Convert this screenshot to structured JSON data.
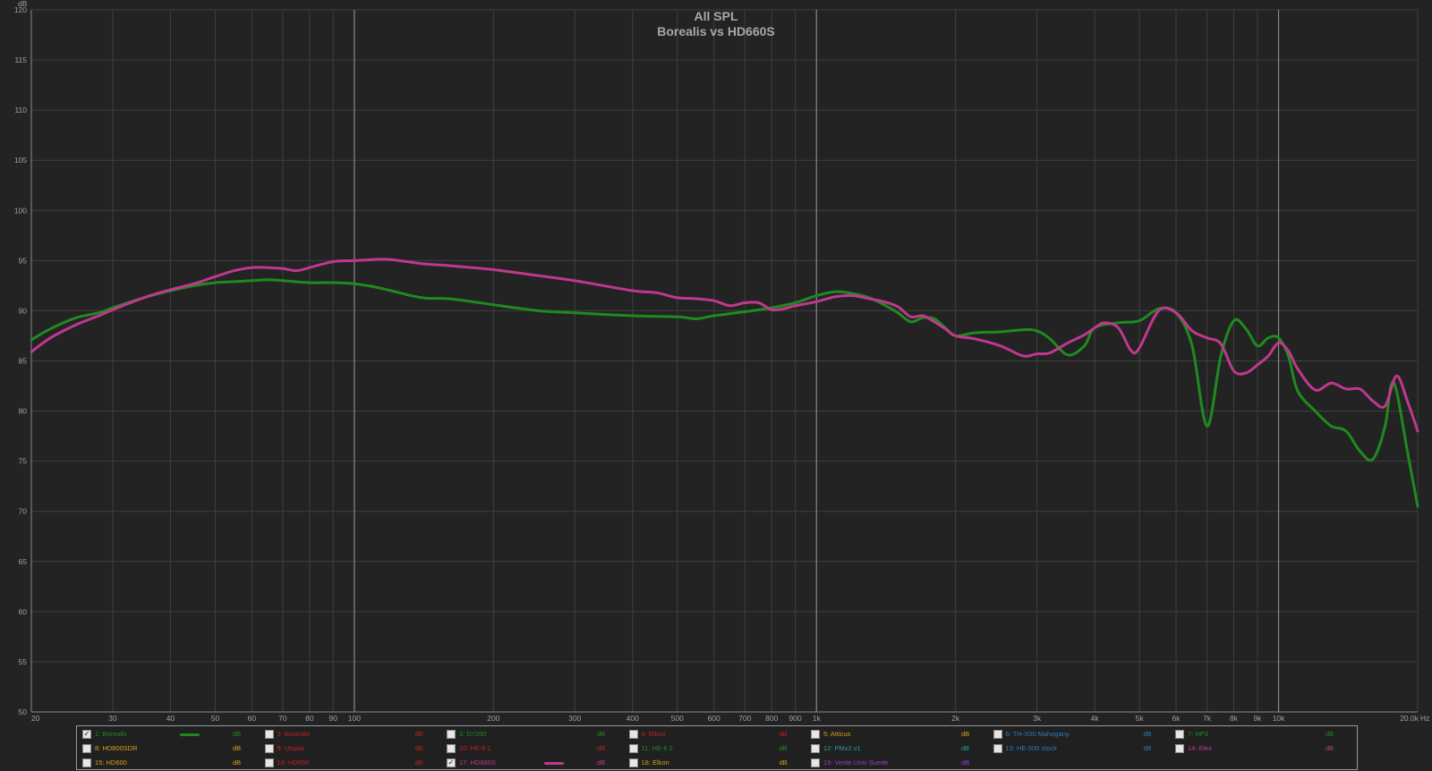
{
  "chart_data": {
    "type": "line",
    "title": "All SPL",
    "subtitle": "Borealis vs HD660S",
    "xlabel": "Hz",
    "ylabel": "dB",
    "xscale": "log",
    "xlim": [
      20,
      20000
    ],
    "ylim": [
      50,
      120
    ],
    "grid": true,
    "y_ticks": [
      "50",
      "55",
      "60",
      "65",
      "70",
      "75",
      "80",
      "85",
      "90",
      "95",
      "100",
      "105",
      "110",
      "115",
      "120"
    ],
    "x_ticks": [
      {
        "v": 20,
        "label": "20"
      },
      {
        "v": 30,
        "label": "30"
      },
      {
        "v": 40,
        "label": "40"
      },
      {
        "v": 50,
        "label": "50"
      },
      {
        "v": 60,
        "label": "60"
      },
      {
        "v": 70,
        "label": "70"
      },
      {
        "v": 80,
        "label": "80"
      },
      {
        "v": 90,
        "label": "90"
      },
      {
        "v": 100,
        "label": "100"
      },
      {
        "v": 200,
        "label": "200"
      },
      {
        "v": 300,
        "label": "300"
      },
      {
        "v": 400,
        "label": "400"
      },
      {
        "v": 500,
        "label": "500"
      },
      {
        "v": 600,
        "label": "600"
      },
      {
        "v": 700,
        "label": "700"
      },
      {
        "v": 800,
        "label": "800"
      },
      {
        "v": 900,
        "label": "900"
      },
      {
        "v": 1000,
        "label": "1k"
      },
      {
        "v": 2000,
        "label": "2k"
      },
      {
        "v": 3000,
        "label": "3k"
      },
      {
        "v": 4000,
        "label": "4k"
      },
      {
        "v": 5000,
        "label": "5k"
      },
      {
        "v": 6000,
        "label": "6k"
      },
      {
        "v": 7000,
        "label": "7k"
      },
      {
        "v": 8000,
        "label": "8k"
      },
      {
        "v": 9000,
        "label": "9k"
      },
      {
        "v": 10000,
        "label": "10k"
      },
      {
        "v": 20000,
        "label": "20.0k"
      }
    ],
    "series": [
      {
        "name": "1: Borealis",
        "color": "#1f8a1f",
        "x": [
          20,
          22,
          25,
          28,
          30,
          35,
          40,
          45,
          50,
          55,
          60,
          65,
          70,
          80,
          90,
          100,
          110,
          120,
          140,
          160,
          180,
          200,
          250,
          300,
          400,
          500,
          550,
          600,
          700,
          800,
          900,
          1000,
          1100,
          1200,
          1300,
          1400,
          1500,
          1600,
          1700,
          1800,
          1900,
          2000,
          2200,
          2500,
          2800,
          3000,
          3200,
          3500,
          3800,
          4000,
          4500,
          5000,
          5500,
          6000,
          6500,
          7000,
          7500,
          8000,
          8500,
          9000,
          9500,
          10000,
          10500,
          11000,
          12000,
          13000,
          14000,
          15000,
          16000,
          17000,
          17500,
          18000,
          19000,
          20000
        ],
        "y": [
          87.1,
          88.2,
          89.3,
          89.8,
          90.3,
          91.3,
          92.0,
          92.5,
          92.8,
          92.9,
          93.0,
          93.1,
          93.0,
          92.8,
          92.8,
          92.7,
          92.4,
          92.0,
          91.3,
          91.2,
          90.9,
          90.6,
          90.0,
          89.8,
          89.5,
          89.4,
          89.2,
          89.5,
          89.9,
          90.3,
          90.8,
          91.5,
          91.9,
          91.7,
          91.3,
          90.6,
          89.8,
          88.9,
          89.3,
          89.2,
          88.3,
          87.5,
          87.8,
          87.9,
          88.1,
          88.0,
          87.2,
          85.6,
          86.5,
          88.3,
          88.8,
          89.0,
          90.2,
          89.8,
          86.5,
          78.5,
          85.5,
          89.0,
          88.2,
          86.5,
          87.3,
          87.3,
          85.5,
          82.0,
          80.0,
          78.5,
          78.0,
          76.0,
          75.2,
          78.5,
          82.5,
          82.0,
          76.0,
          70.5
        ]
      },
      {
        "name": "17: HD660S",
        "color": "#c0388e",
        "x": [
          20,
          22,
          25,
          28,
          30,
          35,
          40,
          45,
          50,
          55,
          60,
          65,
          70,
          75,
          80,
          90,
          100,
          110,
          120,
          140,
          160,
          180,
          200,
          250,
          300,
          400,
          450,
          500,
          550,
          600,
          650,
          700,
          750,
          800,
          850,
          900,
          1000,
          1100,
          1200,
          1300,
          1400,
          1500,
          1600,
          1700,
          1800,
          1900,
          2000,
          2200,
          2500,
          2800,
          3000,
          3200,
          3500,
          3800,
          4000,
          4200,
          4500,
          4800,
          5000,
          5500,
          6000,
          6500,
          7000,
          7500,
          8000,
          8500,
          9000,
          9500,
          10000,
          10500,
          11000,
          12000,
          13000,
          14000,
          15000,
          16000,
          17000,
          18000,
          19000,
          20000
        ],
        "y": [
          85.9,
          87.3,
          88.6,
          89.5,
          90.1,
          91.3,
          92.1,
          92.7,
          93.4,
          94.0,
          94.3,
          94.3,
          94.2,
          94.0,
          94.3,
          94.9,
          95.0,
          95.1,
          95.1,
          94.7,
          94.5,
          94.3,
          94.1,
          93.5,
          93.0,
          92.0,
          91.8,
          91.3,
          91.2,
          91.0,
          90.5,
          90.8,
          90.8,
          90.1,
          90.2,
          90.5,
          90.9,
          91.4,
          91.5,
          91.2,
          90.9,
          90.4,
          89.4,
          89.5,
          88.9,
          88.2,
          87.5,
          87.2,
          86.5,
          85.5,
          85.7,
          85.8,
          86.8,
          87.6,
          88.3,
          88.8,
          88.3,
          86.0,
          86.3,
          90.0,
          89.8,
          88.0,
          87.3,
          86.7,
          84.0,
          83.8,
          84.6,
          85.5,
          86.8,
          86.0,
          84.2,
          82.1,
          82.8,
          82.2,
          82.2,
          81.0,
          80.5,
          83.5,
          81.0,
          78.0
        ]
      }
    ]
  },
  "legend": {
    "unit": "dB",
    "items": [
      {
        "label": "1: Borealis",
        "color": "#1f8a1f",
        "checked": true,
        "col": 0,
        "row": 0
      },
      {
        "label": "2: Australis",
        "color": "#c02020",
        "checked": false,
        "col": 1,
        "row": 0
      },
      {
        "label": "3: D7200",
        "color": "#1f8a1f",
        "checked": false,
        "col": 2,
        "row": 0
      },
      {
        "label": "4: Elkon",
        "color": "#c02020",
        "checked": false,
        "col": 3,
        "row": 0
      },
      {
        "label": "5: Atticus",
        "color": "#d4a017",
        "checked": false,
        "col": 4,
        "row": 0
      },
      {
        "label": "6: TH-X00 Mahogany",
        "color": "#2a7ab8",
        "checked": false,
        "col": 5,
        "row": 0
      },
      {
        "label": "7: HP3",
        "color": "#1f8a1f",
        "checked": false,
        "col": 6,
        "row": 0
      },
      {
        "label": "8: HD800SDR",
        "color": "#d4a017",
        "checked": false,
        "col": 0,
        "row": 1
      },
      {
        "label": "9: Utopia",
        "color": "#c02020",
        "checked": false,
        "col": 1,
        "row": 1
      },
      {
        "label": "10: HE-6 1",
        "color": "#c02020",
        "checked": false,
        "col": 2,
        "row": 1
      },
      {
        "label": "11: HE-6 2",
        "color": "#1f8a1f",
        "checked": false,
        "col": 3,
        "row": 1
      },
      {
        "label": "12: PMx2 v1",
        "color": "#2a9a9a",
        "checked": false,
        "col": 4,
        "row": 1
      },
      {
        "label": "13: HE-500 stock",
        "color": "#2a7ab8",
        "checked": false,
        "col": 5,
        "row": 1
      },
      {
        "label": "14: Elex",
        "color": "#c0388e",
        "checked": false,
        "col": 6,
        "row": 1
      },
      {
        "label": "15: HD600",
        "color": "#d4a017",
        "checked": false,
        "col": 0,
        "row": 2
      },
      {
        "label": "16: HD650",
        "color": "#c02020",
        "checked": false,
        "col": 1,
        "row": 2
      },
      {
        "label": "17: HD660S",
        "color": "#c0388e",
        "checked": true,
        "col": 2,
        "row": 2
      },
      {
        "label": "18: Elkon",
        "color": "#d4a017",
        "checked": false,
        "col": 3,
        "row": 2
      },
      {
        "label": "19: Verite Univ Suede",
        "color": "#9b3cc4",
        "checked": false,
        "col": 4,
        "row": 2
      }
    ]
  }
}
